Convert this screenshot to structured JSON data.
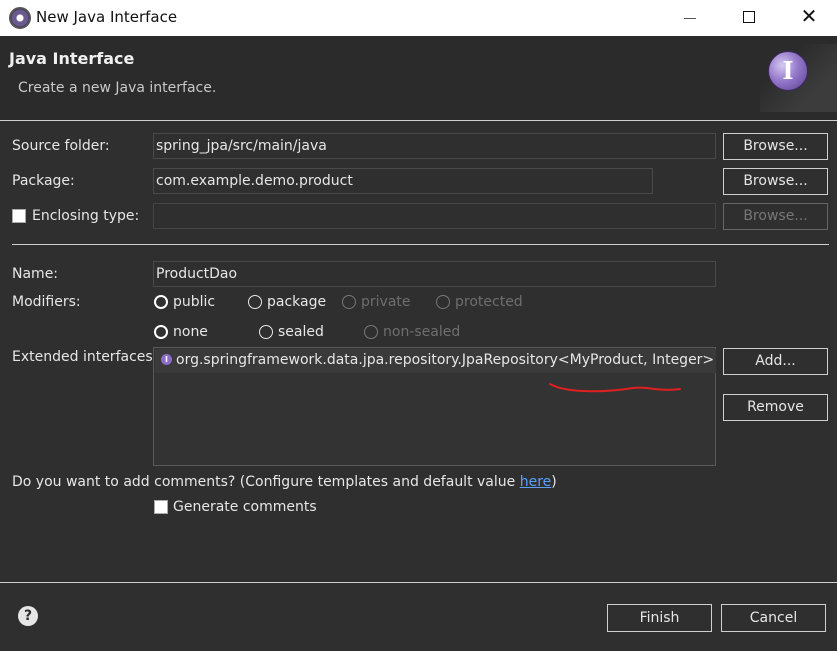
{
  "window": {
    "title": "New Java Interface",
    "icon": "eclipse-icon",
    "controls": [
      "minimize-icon",
      "maximize-icon",
      "close-icon"
    ]
  },
  "header": {
    "title": "Java Interface",
    "subtitle": "Create a new Java interface.",
    "badge_letter": "I"
  },
  "form": {
    "source_folder": {
      "label": "Source folder:",
      "value": "spring_jpa/src/main/java",
      "browse_label": "Browse..."
    },
    "package": {
      "label": "Package:",
      "value": "com.example.demo.product",
      "browse_label": "Browse..."
    },
    "enclosing_type": {
      "label": "Enclosing type:",
      "checked": false,
      "value": "",
      "browse_label": "Browse..."
    },
    "name": {
      "label": "Name:",
      "value": "ProductDao"
    },
    "modifiers": {
      "label": "Modifiers:",
      "access": [
        {
          "label": "public",
          "checked": true,
          "enabled": true
        },
        {
          "label": "package",
          "checked": false,
          "enabled": true
        },
        {
          "label": "private",
          "checked": false,
          "enabled": false
        },
        {
          "label": "protected",
          "checked": false,
          "enabled": false
        }
      ],
      "sealing": [
        {
          "label": "none",
          "checked": true,
          "enabled": true
        },
        {
          "label": "sealed",
          "checked": false,
          "enabled": true
        },
        {
          "label": "non-sealed",
          "checked": false,
          "enabled": false
        }
      ]
    },
    "extended_interfaces": {
      "label": "Extended interfaces:",
      "items": [
        {
          "icon": "interface-icon",
          "text_before": "org.springframework.data.jpa.repository.JpaRepository",
          "text_generic": "<MyProduct, Integer>"
        }
      ],
      "add_label": "Add...",
      "remove_label": "Remove"
    },
    "comments": {
      "question_prefix": "Do you want to add comments? (Configure templates and default value ",
      "link_text": "here",
      "question_suffix": ")",
      "generate_label": "Generate comments",
      "generate_checked": false
    }
  },
  "footer": {
    "help_icon": "help-icon",
    "finish_label": "Finish",
    "cancel_label": "Cancel"
  },
  "colors": {
    "background": "#2f2f2f",
    "annotation_underline": "#e02020",
    "interface_icon": "#8c6cc7",
    "link": "#5aa0ff"
  }
}
